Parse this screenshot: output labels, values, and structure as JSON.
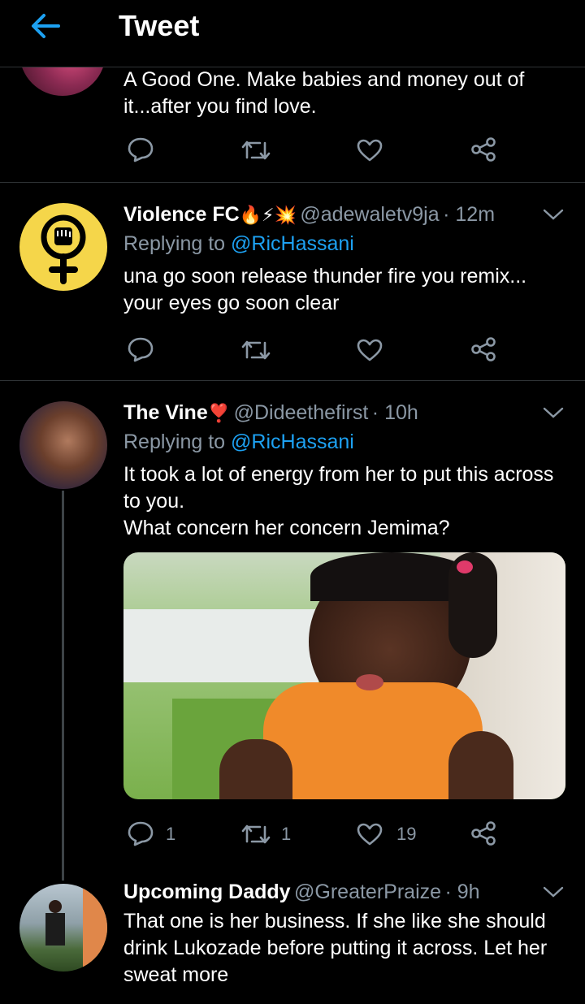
{
  "header": {
    "title": "Tweet"
  },
  "tweets": [
    {
      "text": "A Good One. Make babies and money out of it...after you find love."
    },
    {
      "name": "Violence FC",
      "emojis": "🔥⚡💥",
      "handle": "@adewaletv9ja",
      "time": "· 12m",
      "replying_label": "Replying to",
      "replying_to": "@RicHassani",
      "text": "una go soon release thunder fire you remix... your eyes go soon clear"
    },
    {
      "name": "The Vine",
      "emojis": "❣️",
      "handle": "@Dideethefirst",
      "time": "· 10h",
      "replying_label": "Replying to",
      "replying_to": "@RicHassani",
      "text_line1": "It took a lot of energy from her to put this across to you.",
      "text_line2": "What concern her concern Jemima?",
      "reply_count": "1",
      "retweet_count": "1",
      "like_count": "19"
    },
    {
      "name": "Upcoming Daddy",
      "handle": "@GreaterPraize",
      "time": "· 9h",
      "text": "That one is her business. If she like she should drink Lukozade before putting it across. Let her sweat more"
    }
  ],
  "colors": {
    "accent": "#1da1f2",
    "muted": "#8b98a5",
    "divider": "#2f3336"
  }
}
